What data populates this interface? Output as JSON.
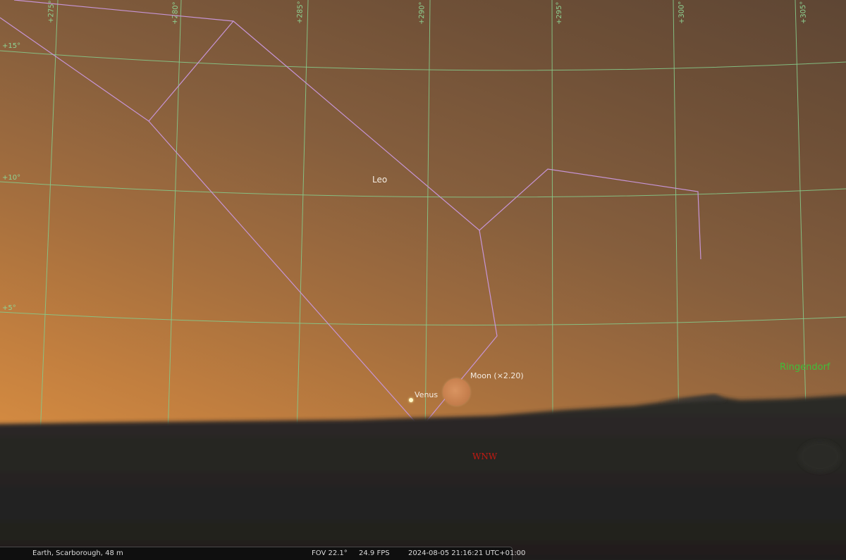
{
  "sky": {
    "grid_ra_labels": [
      "+275°",
      "+280°",
      "+285°",
      "+290°",
      "+295°",
      "+300°",
      "+305°"
    ],
    "grid_dec_labels": [
      "+15°",
      "+10°",
      "+5°"
    ],
    "constellation": "Leo",
    "objects": {
      "moon": "Moon (×2.20)",
      "venus": "Venus"
    },
    "landscape_label": "Ringendorf",
    "compass": "WNW"
  },
  "status_bar": {
    "location": "Earth, Scarborough, 48 m",
    "fov": "FOV 22.1°",
    "fps": "24.9 FPS",
    "datetime": "2024-08-05 21:16:21 UTC+01:00"
  },
  "colors": {
    "grid": "#86c98a",
    "constellation_lines": "#c795d6",
    "landscape_label": "#3fbf3a",
    "compass_label": "#c41a12"
  }
}
